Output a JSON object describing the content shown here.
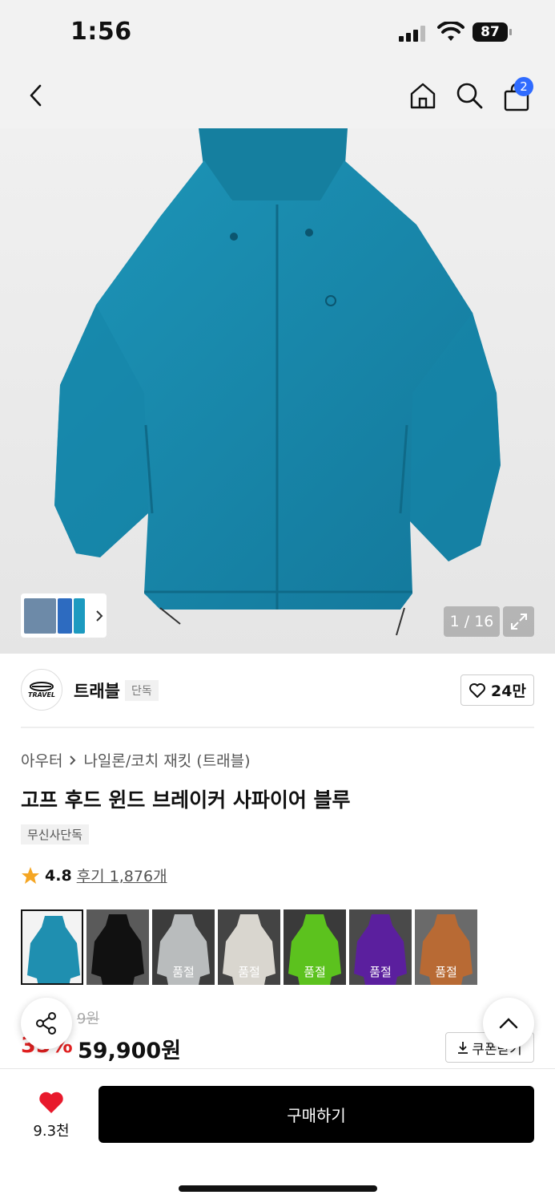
{
  "status_bar": {
    "time": "1:56",
    "battery": "87"
  },
  "nav": {
    "cart_count": "2"
  },
  "gallery": {
    "counter": "1 / 16"
  },
  "brand": {
    "name": "트래블",
    "tag": "단독",
    "logo_text": "TRAVEL",
    "likes": "24만"
  },
  "breadcrumb": {
    "category": "아우터",
    "subcategory": "나일론/코치 재킷 (트래블)"
  },
  "product": {
    "title": "고프 후드 윈드 브레이커 사파이어 블루",
    "exclusive_tag": "무신사단독",
    "rating": "4.8",
    "review_text": "후기 1,876개",
    "original_price_partial": "9원",
    "discount_partial": "35%",
    "price": "59,900원",
    "coupon_label": "쿠폰받기"
  },
  "variants": [
    {
      "color": "#1f8fb0",
      "bg": "#f3f3f3",
      "soldout": "",
      "selected": true
    },
    {
      "color": "#111111",
      "bg": "#5a5a5a",
      "soldout": ""
    },
    {
      "color": "#b9bcbd",
      "bg": "#3c3c3c",
      "soldout": "품절"
    },
    {
      "color": "#d9d6cf",
      "bg": "#444444",
      "soldout": "품절"
    },
    {
      "color": "#5cc21e",
      "bg": "#3a3a3a",
      "soldout": "품절"
    },
    {
      "color": "#5b1f9e",
      "bg": "#4a4a4a",
      "soldout": "품절"
    },
    {
      "color": "#b86a34",
      "bg": "#6a6a6a",
      "soldout": "품절"
    }
  ],
  "bottom_bar": {
    "wish_count": "9.3천",
    "buy_label": "구매하기"
  },
  "colors": {
    "accent": "#2f6bff",
    "discount": "#e02020",
    "heart": "#e8192c",
    "jacket": "#1886a6"
  },
  "icons": [
    "back-icon",
    "home-icon",
    "search-icon",
    "cart-icon",
    "expand-icon",
    "heart-outline-icon",
    "star-icon",
    "share-icon",
    "chevron-up-icon",
    "download-icon",
    "heart-filled-icon"
  ]
}
